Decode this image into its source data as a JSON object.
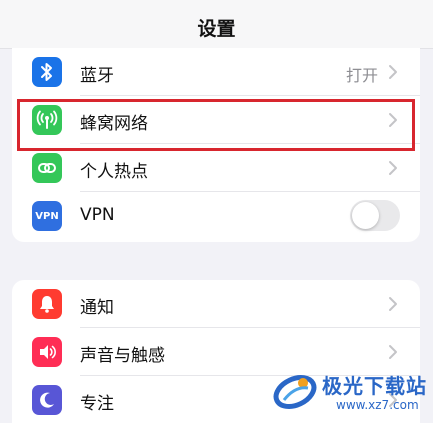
{
  "nav": {
    "title": "设置"
  },
  "groups": [
    {
      "items": [
        {
          "label": "蓝牙",
          "value": "打开",
          "icon": "bluetooth-icon",
          "icon_color": "#1a73e8"
        },
        {
          "label": "蜂窝网络",
          "icon": "antenna-icon",
          "icon_color": "#34c759",
          "highlighted": true
        },
        {
          "label": "个人热点",
          "icon": "hotspot-icon",
          "icon_color": "#34c759"
        },
        {
          "label": "VPN",
          "icon": "vpn-icon",
          "icon_text": "VPN",
          "icon_color": "#2f6fe0",
          "toggle_on": false
        }
      ]
    },
    {
      "items": [
        {
          "label": "通知",
          "icon": "notification-bell-icon",
          "icon_color": "#ff3b30"
        },
        {
          "label": "声音与触感",
          "icon": "speaker-icon",
          "icon_color": "#ff2d55"
        },
        {
          "label": "专注",
          "icon": "moon-icon",
          "icon_color": "#5856d6"
        }
      ]
    }
  ],
  "highlight_color": "#d8262e",
  "watermark": {
    "text": "极光下载站",
    "url": "www.xz7.com"
  }
}
